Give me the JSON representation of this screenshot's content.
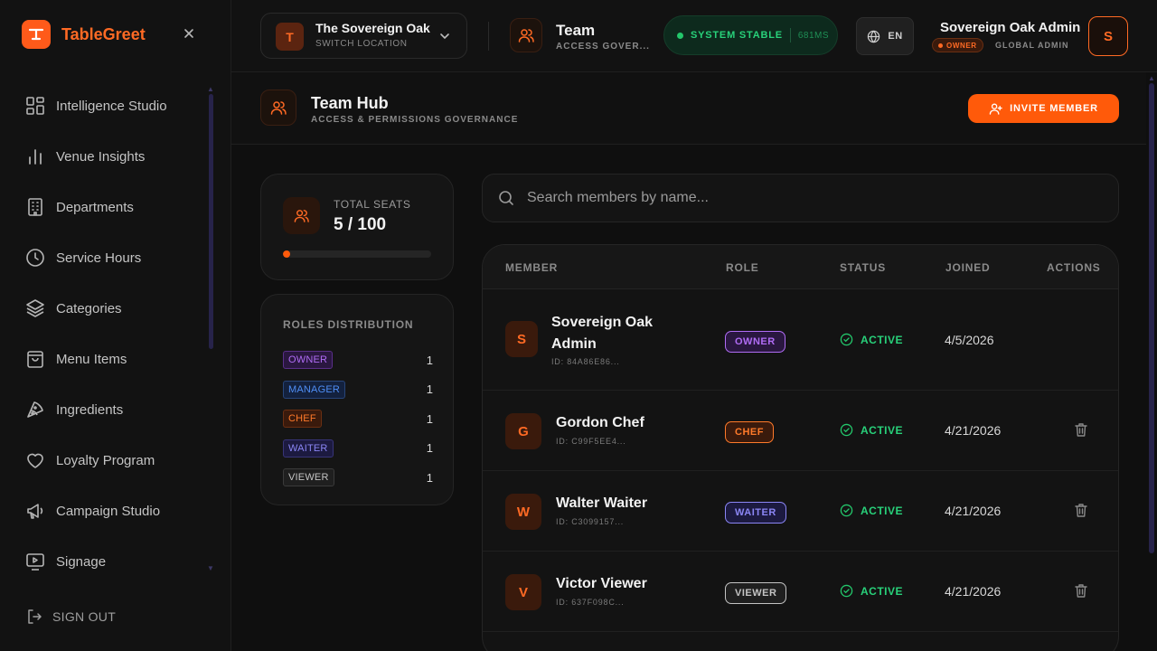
{
  "app": {
    "brand_name": "TableGreet",
    "brand_initial": "T"
  },
  "sidebar": {
    "items": [
      {
        "label": "Intelligence Studio",
        "icon": "grid-icon"
      },
      {
        "label": "Venue Insights",
        "icon": "bar-chart-icon"
      },
      {
        "label": "Departments",
        "icon": "building-icon"
      },
      {
        "label": "Service Hours",
        "icon": "clock-icon"
      },
      {
        "label": "Categories",
        "icon": "layers-icon"
      },
      {
        "label": "Menu Items",
        "icon": "shopping-bag-icon"
      },
      {
        "label": "Ingredients",
        "icon": "pizza-icon"
      },
      {
        "label": "Loyalty Program",
        "icon": "heart-icon"
      },
      {
        "label": "Campaign Studio",
        "icon": "megaphone-icon"
      },
      {
        "label": "Signage",
        "icon": "monitor-play-icon"
      }
    ],
    "sign_out": "SIGN OUT"
  },
  "topbar": {
    "location": {
      "initial": "T",
      "name": "The Sovereign Oak",
      "sub": "SWITCH LOCATION"
    },
    "context": {
      "title": "Team",
      "sub": "ACCESS GOVER..."
    },
    "system": {
      "label": "SYSTEM STABLE",
      "latency": "681MS",
      "color": "#23c76b"
    },
    "language": "EN",
    "user": {
      "name": "Sovereign Oak Admin",
      "role": "OWNER",
      "scope": "GLOBAL ADMIN",
      "initial": "S"
    }
  },
  "page": {
    "title": "Team Hub",
    "subtitle": "ACCESS & PERMISSIONS GOVERNANCE",
    "invite_label": "INVITE MEMBER"
  },
  "seats": {
    "label": "TOTAL SEATS",
    "value": "5 / 100",
    "used": 5,
    "total": 100,
    "accent": "#ff5a0a"
  },
  "roles": {
    "title": "ROLES DISTRIBUTION",
    "items": [
      {
        "label": "OWNER",
        "count": "1"
      },
      {
        "label": "MANAGER",
        "count": "1"
      },
      {
        "label": "CHEF",
        "count": "1"
      },
      {
        "label": "WAITER",
        "count": "1"
      },
      {
        "label": "VIEWER",
        "count": "1"
      }
    ]
  },
  "search": {
    "placeholder": "Search members by name...",
    "value": ""
  },
  "table": {
    "headers": {
      "member": "MEMBER",
      "role": "ROLE",
      "status": "STATUS",
      "joined": "JOINED",
      "actions": "ACTIONS"
    },
    "rows": [
      {
        "initial": "S",
        "name_line1": "Sovereign Oak",
        "name_line2": "Admin",
        "id": "ID: 84A86E86...",
        "role": "OWNER",
        "status": "ACTIVE",
        "joined": "4/5/2026"
      },
      {
        "initial": "G",
        "name": "Gordon Chef",
        "id": "ID: C99F5EE4...",
        "role": "CHEF",
        "status": "ACTIVE",
        "joined": "4/21/2026"
      },
      {
        "initial": "W",
        "name": "Walter Waiter",
        "id": "ID: C3099157...",
        "role": "WAITER",
        "status": "ACTIVE",
        "joined": "4/21/2026"
      },
      {
        "initial": "V",
        "name": "Victor Viewer",
        "id": "ID: 637F098C...",
        "role": "VIEWER",
        "status": "ACTIVE",
        "joined": "4/21/2026"
      }
    ]
  }
}
